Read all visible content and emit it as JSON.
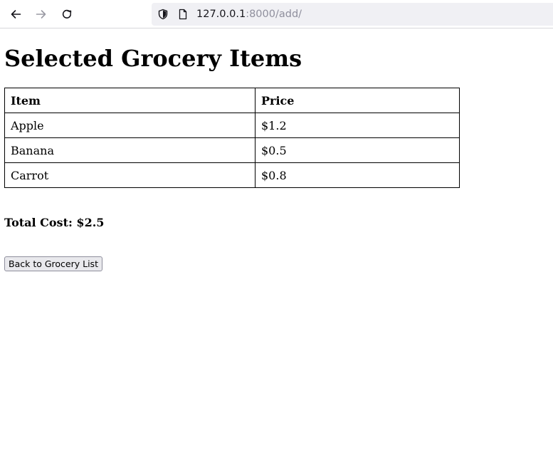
{
  "browser": {
    "url_host": "127.0.0.1",
    "url_rest": ":8000/add/",
    "icons": {
      "back": "arrow-left-icon",
      "forward": "arrow-right-icon",
      "reload": "reload-icon",
      "shield": "shield-icon",
      "page": "page-icon"
    }
  },
  "page": {
    "title": "Selected Grocery Items",
    "table": {
      "headers": [
        "Item",
        "Price"
      ],
      "rows": [
        [
          "Apple",
          "$1.2"
        ],
        [
          "Banana",
          "$0.5"
        ],
        [
          "Carrot",
          "$0.8"
        ]
      ]
    },
    "total_label": "Total Cost: $2.5",
    "back_button_label": "Back to Grocery List"
  }
}
